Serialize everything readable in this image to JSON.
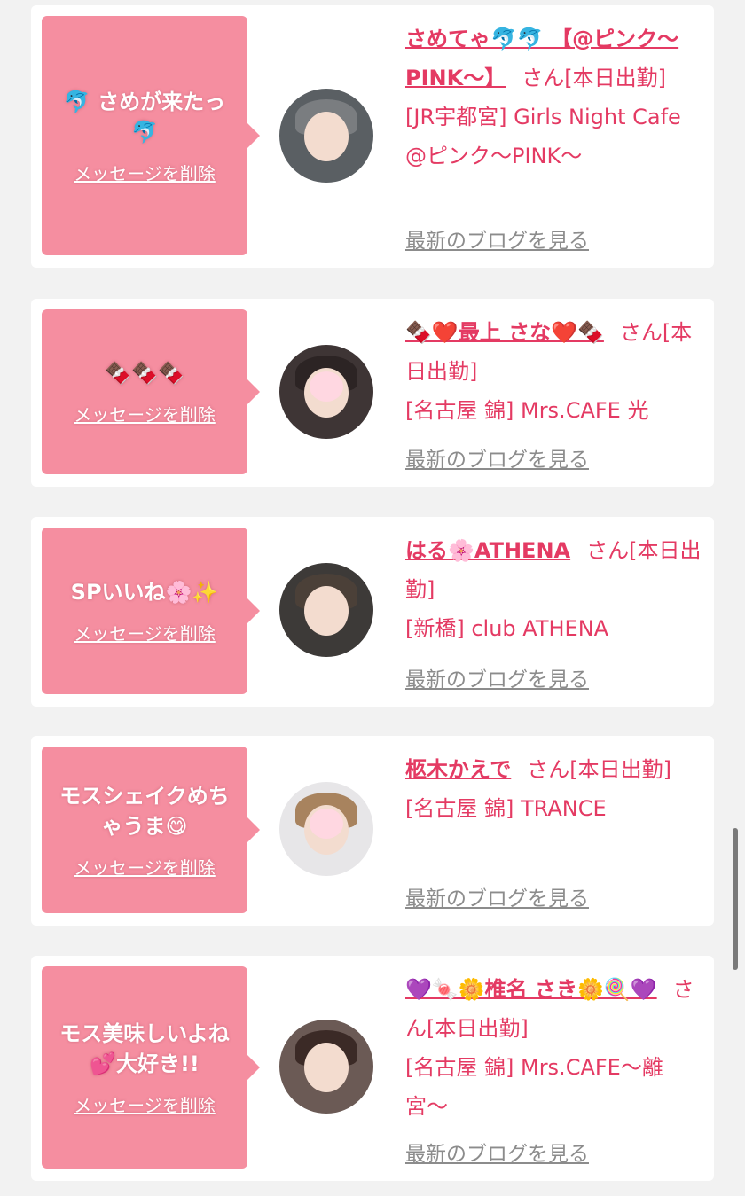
{
  "delete_label": "メッセージを削除",
  "blog_label": "最新のブログを見る",
  "accent_color": "#e43a63",
  "bubble_color": "#f58ea0",
  "items": [
    {
      "message": "🐬 さめが来たっ🐬",
      "name": "さめてゃ🐬🐬 【@ピンク〜PINK〜】",
      "suffix": "さん[本日出勤]",
      "shop": "[JR宇都宮] Girls Night Cafe @ピンク〜PINK〜"
    },
    {
      "message": "🍫🍫🍫",
      "name": "🍫❤️最上 さな❤️🍫",
      "suffix": "さん[本日出勤]",
      "shop": "[名古屋 錦] Mrs.CAFE 光"
    },
    {
      "message": "SPいいね🌸✨",
      "name": "はる🌸ATHENA",
      "suffix": "さん[本日出勤]",
      "shop": "[新橋] club ATHENA"
    },
    {
      "message": "モスシェイクめちゃうま😋",
      "name": "柩木かえで",
      "suffix": "さん[本日出勤]",
      "shop": "[名古屋 錦] TRANCE"
    },
    {
      "message": "モス美味しいよね💕大好き!!",
      "name": "💜🍬🌼椎名 さき🌼🍭💜",
      "suffix": "さん[本日出勤]",
      "shop": "[名古屋 錦] Mrs.CAFE〜離宮〜"
    }
  ]
}
